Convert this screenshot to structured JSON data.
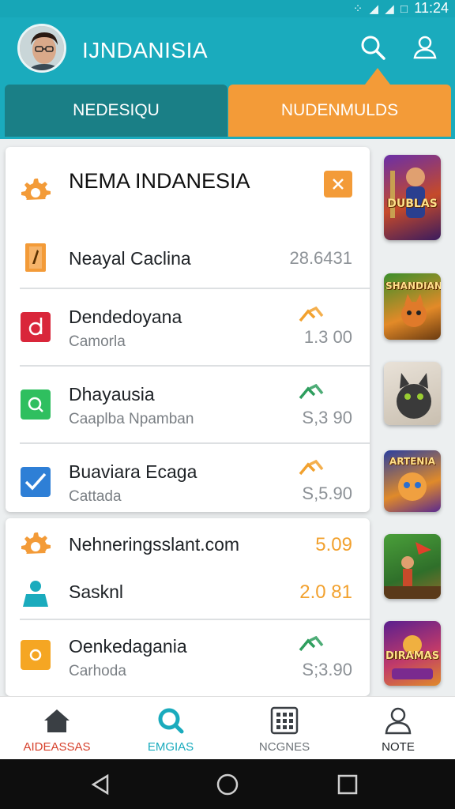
{
  "status_bar": {
    "icons_text": "⁘ ◢ ◢ □",
    "time": "11:24"
  },
  "header": {
    "title": "IJNDANISIA",
    "search_icon": "search-icon",
    "profile_icon": "user-profile-icon"
  },
  "tabs": [
    {
      "label": "NEDESIQU"
    },
    {
      "label": "NUDENMULDS"
    }
  ],
  "card1": {
    "title": "NEMA INDANESIA",
    "header_icon": "gear-icon",
    "close_icon": "close-icon",
    "rows": [
      {
        "title": "Neayal Caclina",
        "subtitle": "",
        "value": "28.6431",
        "icon": "orange-tag-icon",
        "trend": ""
      },
      {
        "title": "Dendedoyana",
        "subtitle": "Camorla",
        "value": "1.3 00",
        "icon": "red-d-icon",
        "trend": "orange"
      },
      {
        "title": "Dhayausia",
        "subtitle": "Caaplba  Npamban",
        "value": "S,3 90",
        "icon": "green-search-icon",
        "trend": "green"
      },
      {
        "title": "Buaviara Ecaga",
        "subtitle": "Cattada",
        "value": "S,5.90",
        "icon": "blue-check-icon",
        "trend": "orange"
      }
    ]
  },
  "card2": {
    "rows": [
      {
        "title": "Nehneringsslant.com",
        "subtitle": "",
        "value": "5.09",
        "icon": "gear-icon",
        "value_color": "#f2a12e"
      },
      {
        "title": "Sasknl",
        "subtitle": "",
        "value": "2.0 81",
        "icon": "person-icon",
        "value_color": "#f2a12e"
      },
      {
        "title": "Oenkedagania",
        "subtitle": "Carhoda",
        "value": "S;3.90",
        "icon": "orange-circle-icon",
        "trend": "green"
      }
    ]
  },
  "thumbnails": [
    {
      "label": "DUBLAS"
    },
    {
      "label": "SHANDIAN"
    },
    {
      "label": ""
    },
    {
      "label": "ARTENIA"
    },
    {
      "label": ""
    },
    {
      "label": "DIRAMAS"
    }
  ],
  "bottom_nav": [
    {
      "label": "AIDEASSAS",
      "icon": "home-icon",
      "color": "#d6402b"
    },
    {
      "label": "EMGIAS",
      "icon": "search-icon",
      "color": "#1aabbd"
    },
    {
      "label": "NCGNES",
      "icon": "grid-icon",
      "color": "#6d7378"
    },
    {
      "label": "NOTE",
      "icon": "user-icon",
      "color": "#1e2226"
    }
  ],
  "colors": {
    "primary": "#1aabbd",
    "accent": "#f39b38",
    "tab_dark": "#1a7f86",
    "trend_green": "#2e9e5e",
    "trend_orange": "#f2a12e"
  }
}
